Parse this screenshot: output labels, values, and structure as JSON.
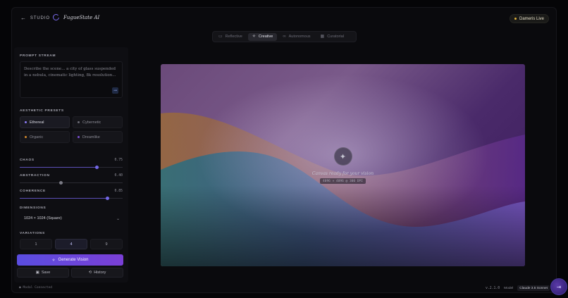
{
  "header": {
    "back_label": "STUDIO",
    "brand_name": "FugueState AI",
    "live_label": "Dameris Live"
  },
  "modes": [
    {
      "label": "Reflective",
      "icon": "book-icon",
      "active": false
    },
    {
      "label": "Creative",
      "icon": "wand-icon",
      "active": true
    },
    {
      "label": "Autonomous",
      "icon": "infinity-icon",
      "active": false
    },
    {
      "label": "Curatorial",
      "icon": "grid-icon",
      "active": false
    }
  ],
  "sidebar": {
    "prompt_label": "PROMPT STREAM",
    "prompt_placeholder": "Describe the scene... a city of glass suspended in a nebula, cinematic lighting, 8k resolution...",
    "presets_label": "AESTHETIC PRESETS",
    "presets": [
      {
        "label": "Ethereal",
        "color": "#8b7cf6",
        "active": true
      },
      {
        "label": "Cybernetic",
        "color": "#6b6b75",
        "active": false
      },
      {
        "label": "Organic",
        "color": "#d38a2e",
        "active": false
      },
      {
        "label": "Dreamlike",
        "color": "#7b4fd6",
        "active": false
      }
    ],
    "sliders": [
      {
        "label": "CHAOS",
        "value_text": "0.75",
        "value": 0.75,
        "thumb_color": "#7468e8"
      },
      {
        "label": "ABSTRACTION",
        "value_text": "0.40",
        "value": 0.4,
        "thumb_color": "#7a7a84"
      },
      {
        "label": "COHERENCE",
        "value_text": "0.85",
        "value": 0.85,
        "thumb_color": "#7468e8"
      }
    ],
    "dimensions_label": "DIMENSIONS",
    "dimensions_value": "1024 × 1024 (Square)",
    "variations_label": "VARIATIONS",
    "variations": [
      {
        "label": "1",
        "active": false
      },
      {
        "label": "4",
        "active": true
      },
      {
        "label": "9",
        "active": false
      }
    ],
    "generate_label": "Generate Vision",
    "save_label": "Save",
    "history_label": "History"
  },
  "canvas": {
    "message": "Canvas ready for your vision",
    "resolution": "4096 × 4096 @ 300 DPI"
  },
  "status": {
    "connection": "● Modal Connected",
    "version": "v.2.1.0",
    "model_label": "Model",
    "model_value": "Claude 3.5 Sonnet"
  }
}
